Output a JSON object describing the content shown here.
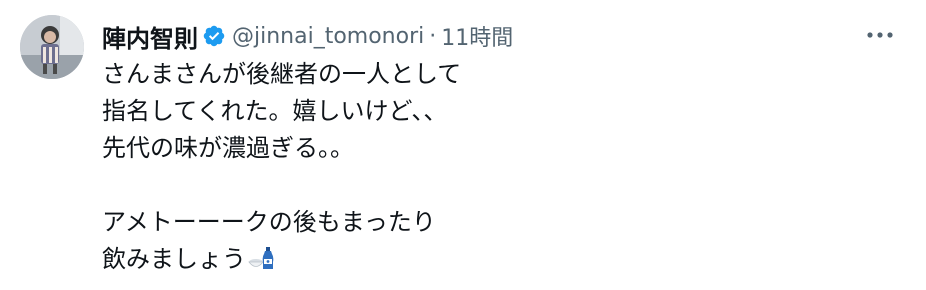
{
  "tweet": {
    "author": {
      "display_name": "陣内智則",
      "verified": true,
      "handle": "@jinnai_tomonori",
      "separator": "·",
      "time": "11時間",
      "avatar_icon": "avatar-photo",
      "verified_icon": "verified-badge-icon"
    },
    "more_icon": "more-options-icon",
    "text_lines": [
      "さんまさんが後継者の一人として",
      "指名してくれた。嬉しいけど、、",
      "先代の味が濃過ぎる。。",
      "",
      "アメトーーークの後もまったり",
      "飲みましょう"
    ],
    "trailing_emoji": "sake-icon"
  },
  "colors": {
    "text": "#0f1419",
    "secondary": "#536471",
    "verified": "#1d9bf0"
  }
}
